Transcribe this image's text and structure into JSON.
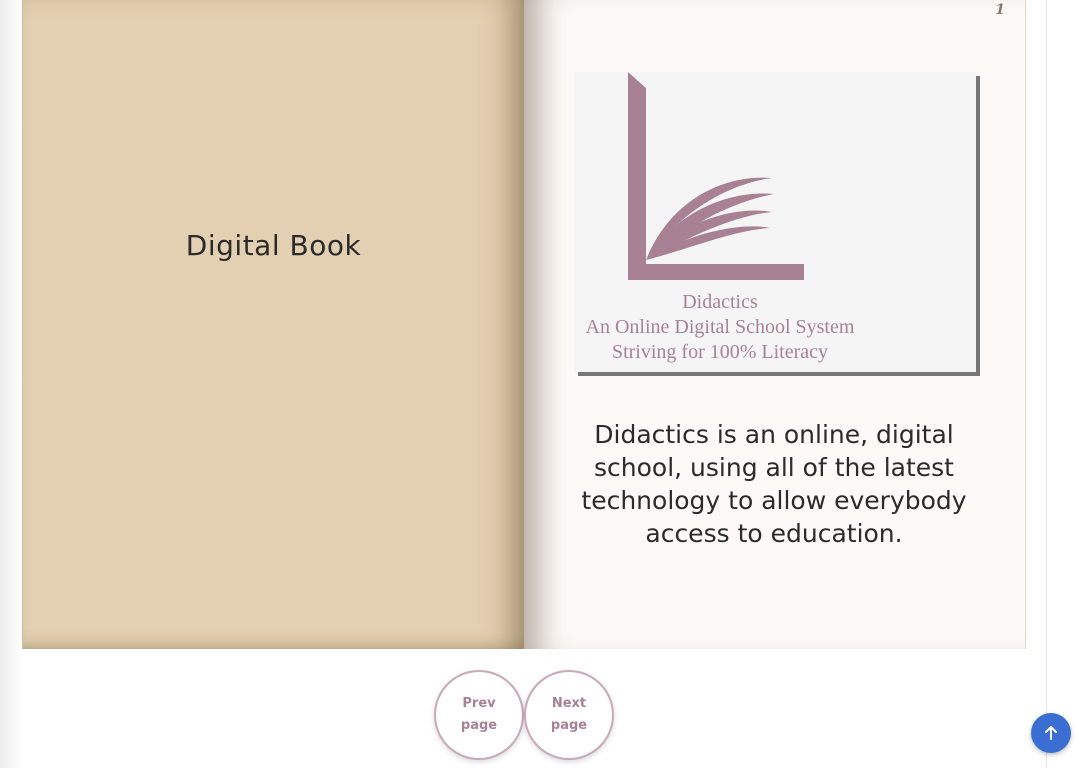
{
  "book": {
    "cover": {
      "title": "Digital Book"
    },
    "page": {
      "number": "1",
      "logo": {
        "name": "Didactics",
        "tagline": "An Online Digital School System",
        "motto": "Striving for 100% Literacy"
      },
      "description": "Didactics is an online, digital school, using all of the latest technology to allow everybody access to education."
    }
  },
  "navigation": {
    "prev_label_line1": "Prev",
    "prev_label_line2": "page",
    "next_label_line1": "Next",
    "next_label_line2": "page"
  },
  "colors": {
    "cover": "#e3cfb1",
    "page": "#fdf9f6",
    "accent": "#a88294",
    "scroll_button": "#3b6ed3"
  },
  "icons": {
    "scroll_top": "arrow-up-icon",
    "logo": "book-logo-icon"
  }
}
